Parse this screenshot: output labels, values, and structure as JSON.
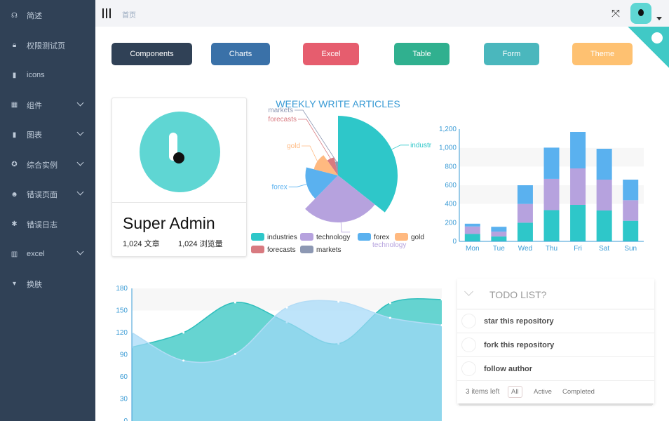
{
  "sidebar": {
    "items": [
      {
        "label": "简述",
        "icon": "dashboard-icon",
        "expandable": false
      },
      {
        "label": "权限测试页",
        "icon": "lock-icon",
        "expandable": false
      },
      {
        "label": "icons",
        "icon": "icons-icon",
        "expandable": false
      },
      {
        "label": "组件",
        "icon": "component-icon",
        "expandable": true
      },
      {
        "label": "图表",
        "icon": "chart-icon",
        "expandable": true
      },
      {
        "label": "综合实例",
        "icon": "example-icon",
        "expandable": true
      },
      {
        "label": "错误页面",
        "icon": "404-icon",
        "expandable": true
      },
      {
        "label": "错误日志",
        "icon": "bug-icon",
        "expandable": false
      },
      {
        "label": "excel",
        "icon": "excel-icon",
        "expandable": true
      },
      {
        "label": "换肤",
        "icon": "theme-icon",
        "expandable": false
      }
    ]
  },
  "header": {
    "breadcrumb": "首页"
  },
  "buttons": [
    {
      "label": "Components",
      "color": "#304156"
    },
    {
      "label": "Charts",
      "color": "#3a71a8"
    },
    {
      "label": "Excel",
      "color": "#e65d6e"
    },
    {
      "label": "Table",
      "color": "#30b08f"
    },
    {
      "label": "Form",
      "color": "#4ab7bd"
    },
    {
      "label": "Theme",
      "color": "#fec171"
    }
  ],
  "user_card": {
    "name": "Super Admin",
    "articles": "1,024 文章",
    "views": "1,024 浏览量"
  },
  "chart_data": [
    {
      "type": "pie",
      "rose": true,
      "title": "WEEKLY WRITE ARTICLES",
      "slices": [
        {
          "name": "industries",
          "value": 320,
          "color": "#2ec7c9"
        },
        {
          "name": "technology",
          "value": 240,
          "color": "#b6a2de"
        },
        {
          "name": "forex",
          "value": 149,
          "color": "#5ab1ef"
        },
        {
          "name": "gold",
          "value": 100,
          "color": "#ffb980"
        },
        {
          "name": "forecasts",
          "value": 59,
          "color": "#d87a80"
        },
        {
          "name": "markets",
          "value": 30,
          "color": "#8d98b3"
        }
      ],
      "slice_labels": [
        "industr",
        "technology",
        "forex",
        "gold",
        "forecasts",
        "markets"
      ],
      "legend": [
        "industries",
        "technology",
        "forex",
        "gold",
        "forecasts",
        "markets"
      ],
      "legend_position": "bottom"
    },
    {
      "type": "bar",
      "stacked": true,
      "categories": [
        "Mon",
        "Tue",
        "Wed",
        "Thu",
        "Fri",
        "Sat",
        "Sun"
      ],
      "series": [
        {
          "values": [
            79,
            52,
            200,
            334,
            390,
            330,
            220
          ],
          "color": "#2ec7c9"
        },
        {
          "values": [
            80,
            52,
            200,
            334,
            390,
            330,
            220
          ],
          "color": "#b6a2de"
        },
        {
          "values": [
            30,
            52,
            200,
            334,
            390,
            330,
            220
          ],
          "color": "#5ab1ef"
        }
      ],
      "ylim": [
        0,
        1200
      ],
      "yticks": [
        "0",
        "200",
        "400",
        "600",
        "800",
        "1,000",
        "1,200"
      ]
    },
    {
      "type": "area",
      "smooth": true,
      "series": [
        {
          "values": [
            100,
            120,
            161,
            134,
            105,
            160,
            165
          ],
          "color": "#40c9c6"
        },
        {
          "values": [
            120,
            82,
            91,
            154,
            162,
            140,
            130
          ],
          "color": "#a3d8f8"
        }
      ],
      "ylim": [
        0,
        180
      ],
      "yticks": [
        "0",
        "30",
        "60",
        "90",
        "120",
        "150",
        "180"
      ]
    }
  ],
  "todo": {
    "title": "TODO LIST?",
    "items": [
      "star this repository",
      "fork this repository",
      "follow author"
    ],
    "footer": {
      "left": "3 items left",
      "filters": [
        "All",
        "Active",
        "Completed"
      ],
      "selected": "All"
    }
  }
}
